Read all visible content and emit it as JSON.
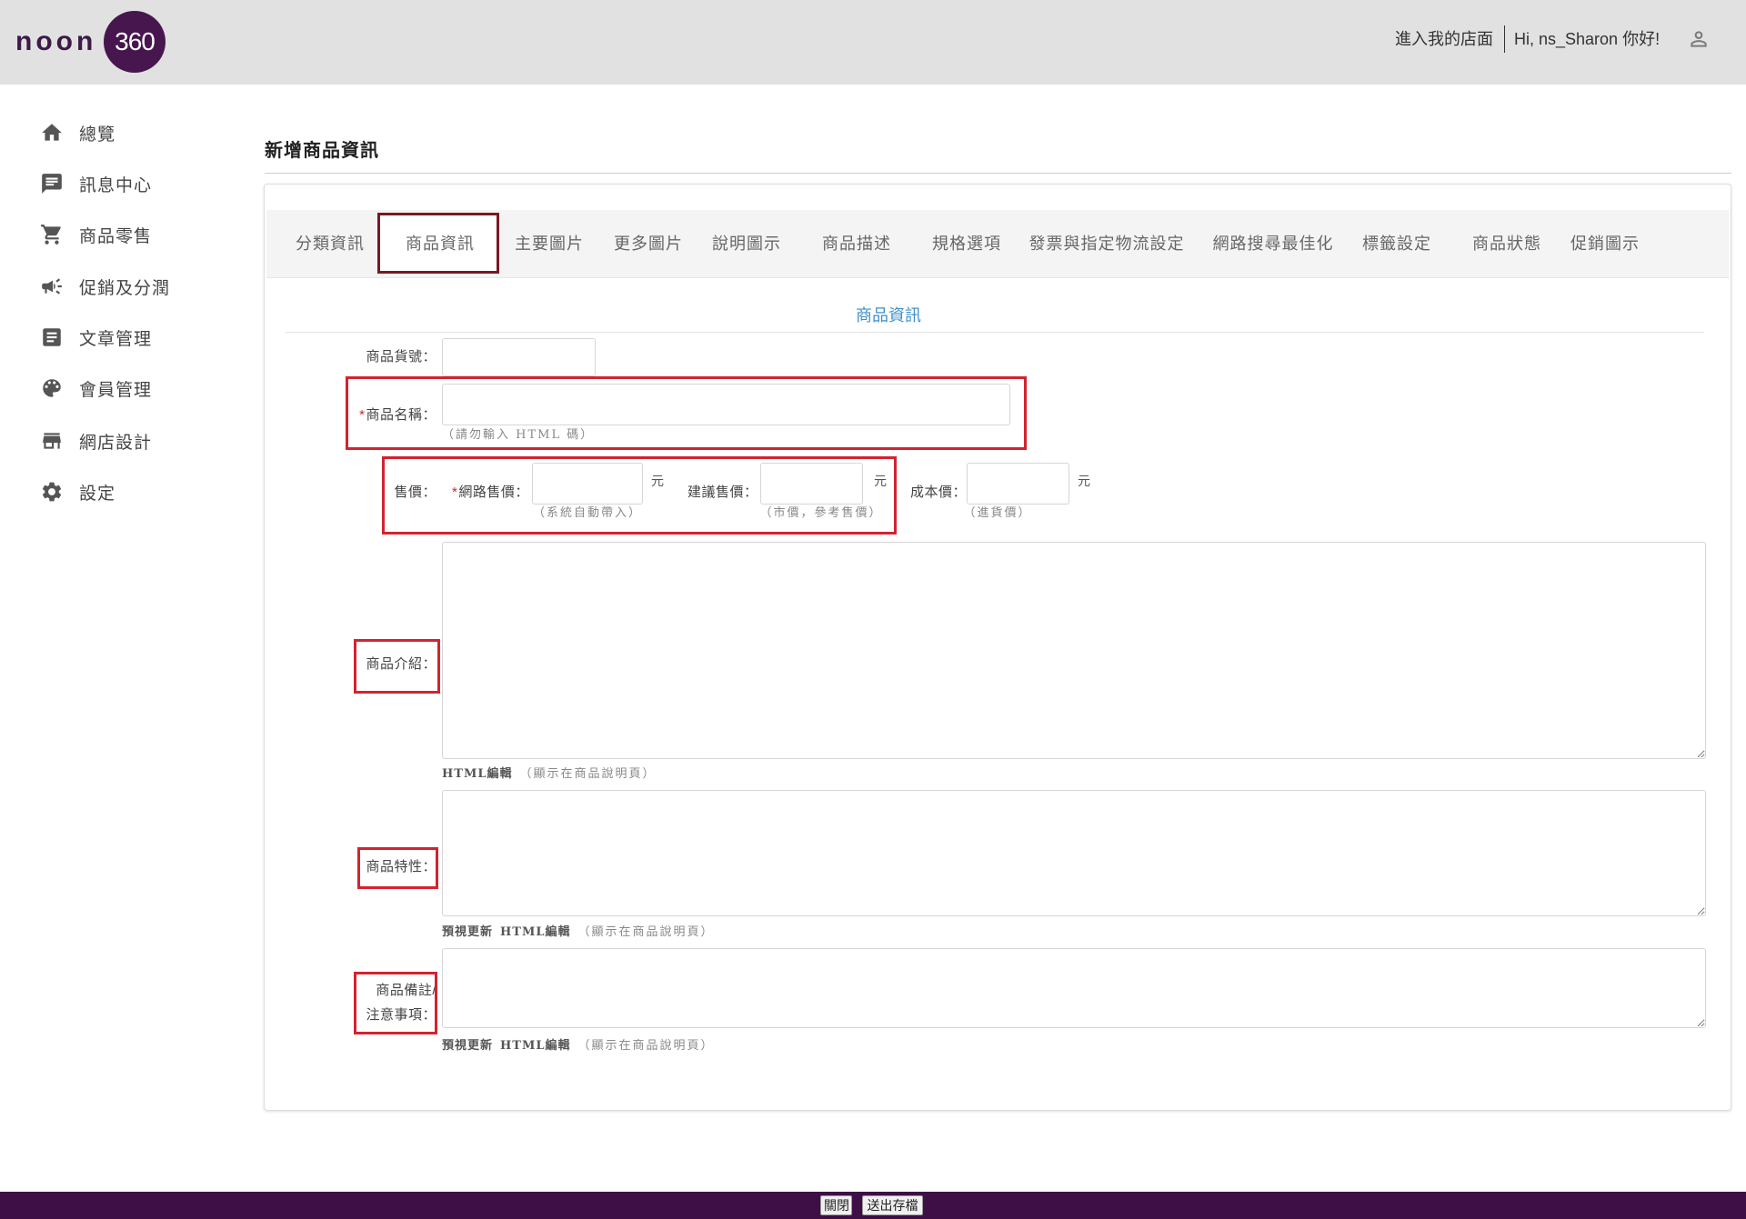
{
  "header": {
    "logo": {
      "word": "noon",
      "number": "360"
    },
    "store_link": "進入我的店面",
    "greeting": "Hi, ns_Sharon 你好!",
    "user_icon": "user-icon"
  },
  "sidebar": {
    "items": [
      {
        "label": "總覽",
        "icon": "home-icon"
      },
      {
        "label": "訊息中心",
        "icon": "chat-icon"
      },
      {
        "label": "商品零售",
        "icon": "cart-icon"
      },
      {
        "label": "促銷及分潤",
        "icon": "megaphone-icon"
      },
      {
        "label": "文章管理",
        "icon": "article-icon"
      },
      {
        "label": "會員管理",
        "icon": "palette-icon"
      },
      {
        "label": "網店設計",
        "icon": "store-icon"
      },
      {
        "label": "設定",
        "icon": "gear-icon"
      }
    ]
  },
  "page": {
    "title": "新增商品資訊"
  },
  "tabs": {
    "items": [
      {
        "label": "分類資訊"
      },
      {
        "label": "商品資訊",
        "active": true
      },
      {
        "label": "主要圖片"
      },
      {
        "label": "更多圖片"
      },
      {
        "label": "說明圖示"
      },
      {
        "label": "商品描述"
      },
      {
        "label": "規格選項"
      },
      {
        "label": "發票與指定物流設定"
      },
      {
        "label": "網路搜尋最佳化"
      },
      {
        "label": "標籤設定"
      },
      {
        "label": "商品狀態"
      },
      {
        "label": "促銷圖示"
      }
    ]
  },
  "form": {
    "section_title": "商品資訊",
    "sku": {
      "label": "商品貨號：",
      "value": ""
    },
    "name": {
      "required_mark": "*",
      "label": "商品名稱：",
      "value": "",
      "hint": "（請勿輸入 HTML 碼）"
    },
    "price": {
      "label": "售價：",
      "online": {
        "required_mark": "*",
        "label": "網路售價：",
        "value": "",
        "unit": "元",
        "hint": "（系統自動帶入）"
      },
      "suggested": {
        "label": "建議售價：",
        "value": "",
        "unit": "元",
        "hint": "（市價，參考售價）"
      },
      "cost": {
        "label": "成本價：",
        "value": "",
        "unit": "元",
        "hint": "（進貨價）"
      }
    },
    "intro": {
      "label": "商品介紹：",
      "value": "",
      "html_edit": "HTML編輯",
      "hint": "（顯示在商品說明頁）"
    },
    "features": {
      "label": "商品特性：",
      "value": "",
      "preview": "預視更新",
      "html_edit": "HTML編輯",
      "hint": "（顯示在商品說明頁）"
    },
    "notes": {
      "label_line1": "商品備註/",
      "label_line2": "注意事項：",
      "value": "",
      "preview": "預視更新",
      "html_edit": "HTML編輯",
      "hint": "（顯示在商品說明頁）"
    }
  },
  "footer": {
    "close": "關閉",
    "submit": "送出存檔"
  },
  "colors": {
    "brand_purple": "#47164f",
    "footer_purple": "#3d0f46",
    "header_bg": "#e1e1e1",
    "accent_blue": "#3e8fc9",
    "annotation_red": "#d32330",
    "active_tab_border": "#7a1722",
    "required_red": "#d0212c"
  }
}
